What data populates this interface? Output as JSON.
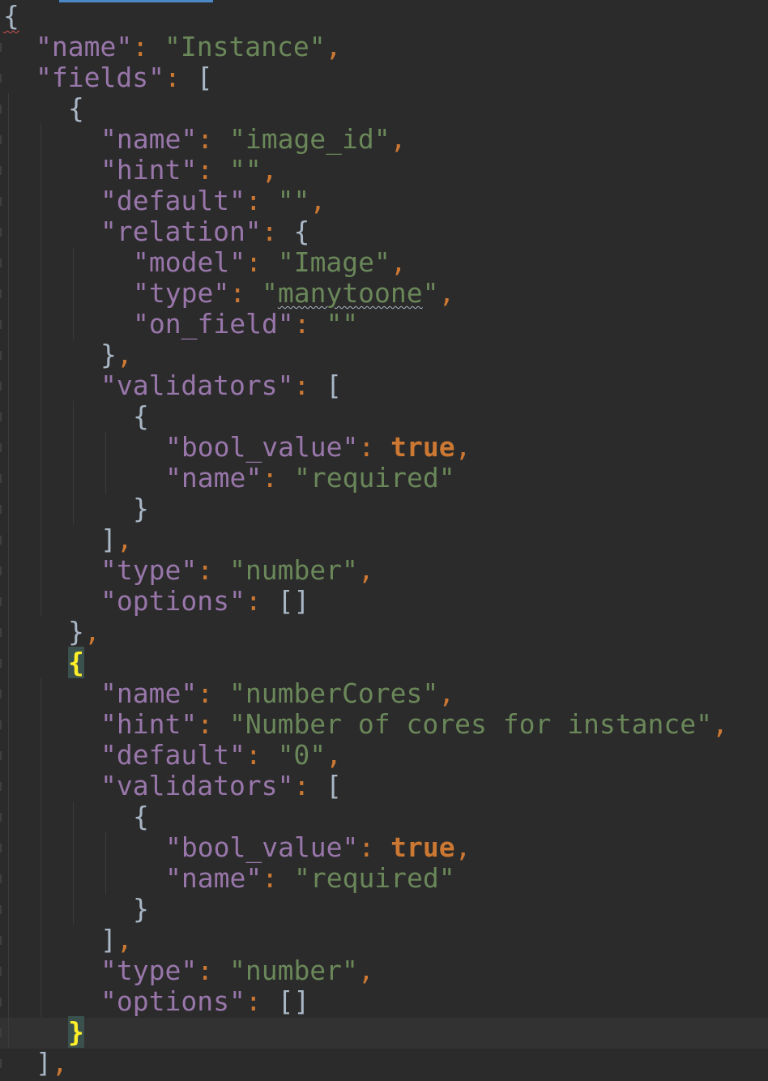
{
  "editor": {
    "language": "json",
    "colors": {
      "background": "#2b2b2b",
      "key": "#9876aa",
      "string": "#6a8759",
      "keyword": "#cc7832",
      "punctuation": "#cc7832",
      "bracket": "#a9b7c6",
      "bracket_match": "#ffef28"
    },
    "lines": [
      {
        "tokens": [
          {
            "t": "{",
            "c": "b err"
          }
        ]
      },
      {
        "tokens": [
          {
            "t": "\"name\"",
            "c": "k"
          },
          {
            "t": ": ",
            "c": "p"
          },
          {
            "t": "\"Instance\"",
            "c": "s"
          },
          {
            "t": ",",
            "c": "p"
          }
        ]
      },
      {
        "tokens": [
          {
            "t": "\"fields\"",
            "c": "k"
          },
          {
            "t": ": ",
            "c": "p"
          },
          {
            "t": "[",
            "c": "b"
          }
        ]
      },
      {
        "tokens": [
          {
            "t": "{",
            "c": "b"
          }
        ]
      },
      {
        "tokens": [
          {
            "t": "\"name\"",
            "c": "k"
          },
          {
            "t": ": ",
            "c": "p"
          },
          {
            "t": "\"image_id\"",
            "c": "s"
          },
          {
            "t": ",",
            "c": "p"
          }
        ]
      },
      {
        "tokens": [
          {
            "t": "\"hint\"",
            "c": "k"
          },
          {
            "t": ": ",
            "c": "p"
          },
          {
            "t": "\"\"",
            "c": "s"
          },
          {
            "t": ",",
            "c": "p"
          }
        ]
      },
      {
        "tokens": [
          {
            "t": "\"default\"",
            "c": "k"
          },
          {
            "t": ": ",
            "c": "p"
          },
          {
            "t": "\"\"",
            "c": "s"
          },
          {
            "t": ",",
            "c": "p"
          }
        ]
      },
      {
        "tokens": [
          {
            "t": "\"relation\"",
            "c": "k"
          },
          {
            "t": ": ",
            "c": "p"
          },
          {
            "t": "{",
            "c": "b"
          }
        ]
      },
      {
        "tokens": [
          {
            "t": "\"model\"",
            "c": "k"
          },
          {
            "t": ": ",
            "c": "p"
          },
          {
            "t": "\"Image\"",
            "c": "s"
          },
          {
            "t": ",",
            "c": "p"
          }
        ]
      },
      {
        "tokens": [
          {
            "t": "\"type\"",
            "c": "k"
          },
          {
            "t": ": ",
            "c": "p"
          },
          {
            "t": "\"",
            "c": "s"
          },
          {
            "t": "manytoone",
            "c": "s squiggle"
          },
          {
            "t": "\"",
            "c": "s"
          },
          {
            "t": ",",
            "c": "p"
          }
        ]
      },
      {
        "tokens": [
          {
            "t": "\"on_field\"",
            "c": "k"
          },
          {
            "t": ": ",
            "c": "p"
          },
          {
            "t": "\"\"",
            "c": "s"
          }
        ]
      },
      {
        "tokens": [
          {
            "t": "}",
            "c": "b"
          },
          {
            "t": ",",
            "c": "p"
          }
        ]
      },
      {
        "tokens": [
          {
            "t": "\"validators\"",
            "c": "k"
          },
          {
            "t": ": ",
            "c": "p"
          },
          {
            "t": "[",
            "c": "b"
          }
        ]
      },
      {
        "tokens": [
          {
            "t": "{",
            "c": "b"
          }
        ]
      },
      {
        "tokens": [
          {
            "t": "\"bool_value\"",
            "c": "k"
          },
          {
            "t": ": ",
            "c": "p"
          },
          {
            "t": "true",
            "c": "kw"
          },
          {
            "t": ",",
            "c": "p"
          }
        ]
      },
      {
        "tokens": [
          {
            "t": "\"name\"",
            "c": "k"
          },
          {
            "t": ": ",
            "c": "p"
          },
          {
            "t": "\"required\"",
            "c": "s"
          }
        ]
      },
      {
        "tokens": [
          {
            "t": "}",
            "c": "b"
          }
        ]
      },
      {
        "tokens": [
          {
            "t": "]",
            "c": "b"
          },
          {
            "t": ",",
            "c": "p"
          }
        ]
      },
      {
        "tokens": [
          {
            "t": "\"type\"",
            "c": "k"
          },
          {
            "t": ": ",
            "c": "p"
          },
          {
            "t": "\"number\"",
            "c": "s"
          },
          {
            "t": ",",
            "c": "p"
          }
        ]
      },
      {
        "tokens": [
          {
            "t": "\"options\"",
            "c": "k"
          },
          {
            "t": ": ",
            "c": "p"
          },
          {
            "t": "[]",
            "c": "b"
          }
        ]
      },
      {
        "tokens": [
          {
            "t": "}",
            "c": "b"
          },
          {
            "t": ",",
            "c": "p"
          }
        ]
      },
      {
        "tokens": [
          {
            "t": "{",
            "c": "match"
          }
        ]
      },
      {
        "tokens": [
          {
            "t": "\"name\"",
            "c": "k"
          },
          {
            "t": ": ",
            "c": "p"
          },
          {
            "t": "\"numberCores\"",
            "c": "s"
          },
          {
            "t": ",",
            "c": "p"
          }
        ]
      },
      {
        "tokens": [
          {
            "t": "\"hint\"",
            "c": "k"
          },
          {
            "t": ": ",
            "c": "p"
          },
          {
            "t": "\"Number of cores for instance\"",
            "c": "s"
          },
          {
            "t": ",",
            "c": "p"
          }
        ]
      },
      {
        "tokens": [
          {
            "t": "\"default\"",
            "c": "k"
          },
          {
            "t": ": ",
            "c": "p"
          },
          {
            "t": "\"0\"",
            "c": "s"
          },
          {
            "t": ",",
            "c": "p"
          }
        ]
      },
      {
        "tokens": [
          {
            "t": "\"validators\"",
            "c": "k"
          },
          {
            "t": ": ",
            "c": "p"
          },
          {
            "t": "[",
            "c": "b"
          }
        ]
      },
      {
        "tokens": [
          {
            "t": "{",
            "c": "b"
          }
        ]
      },
      {
        "tokens": [
          {
            "t": "\"bool_value\"",
            "c": "k"
          },
          {
            "t": ": ",
            "c": "p"
          },
          {
            "t": "true",
            "c": "kw"
          },
          {
            "t": ",",
            "c": "p"
          }
        ]
      },
      {
        "tokens": [
          {
            "t": "\"name\"",
            "c": "k"
          },
          {
            "t": ": ",
            "c": "p"
          },
          {
            "t": "\"required\"",
            "c": "s"
          }
        ]
      },
      {
        "tokens": [
          {
            "t": "}",
            "c": "b"
          }
        ]
      },
      {
        "tokens": [
          {
            "t": "]",
            "c": "b"
          },
          {
            "t": ",",
            "c": "p"
          }
        ]
      },
      {
        "tokens": [
          {
            "t": "\"type\"",
            "c": "k"
          },
          {
            "t": ": ",
            "c": "p"
          },
          {
            "t": "\"number\"",
            "c": "s"
          },
          {
            "t": ",",
            "c": "p"
          }
        ]
      },
      {
        "tokens": [
          {
            "t": "\"options\"",
            "c": "k"
          },
          {
            "t": ": ",
            "c": "p"
          },
          {
            "t": "[]",
            "c": "b"
          }
        ]
      },
      {
        "tokens": [
          {
            "t": "}",
            "c": "match"
          }
        ]
      },
      {
        "tokens": [
          {
            "t": "]",
            "c": "b"
          },
          {
            "t": ",",
            "c": "p"
          }
        ]
      }
    ]
  }
}
